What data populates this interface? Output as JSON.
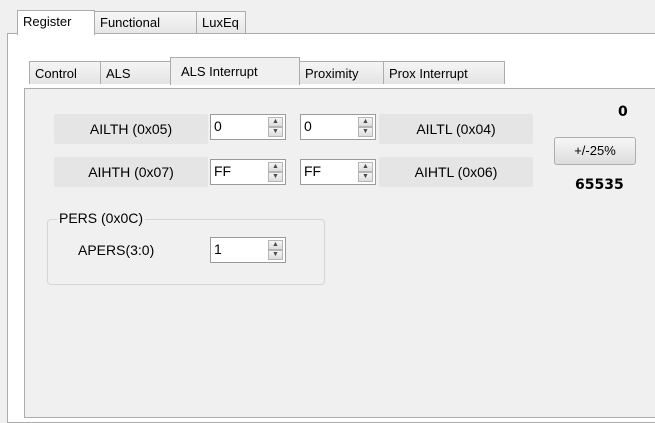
{
  "top_tabs": [
    "Register",
    "Functional",
    "LuxEq"
  ],
  "sub_tabs": [
    "Control",
    "ALS",
    "ALS Interrupt",
    "Proximity",
    "Prox Interrupt"
  ],
  "active_top_tab": "Register",
  "active_sub_tab": "ALS Interrupt",
  "rows": [
    {
      "left_label": "AILTH (0x05)",
      "left_value": "0",
      "right_value": "0",
      "right_label": "AILTL (0x04)"
    },
    {
      "left_label": "AIHTH (0x07)",
      "left_value": "FF",
      "right_value": "FF",
      "right_label": "AIHTL (0x06)"
    }
  ],
  "range_button": "+/-25%",
  "low_threshold": "0",
  "high_threshold": "65535",
  "pers_group": {
    "title": "PERS (0x0C)",
    "label": "APERS(3:0)",
    "value": "1"
  }
}
